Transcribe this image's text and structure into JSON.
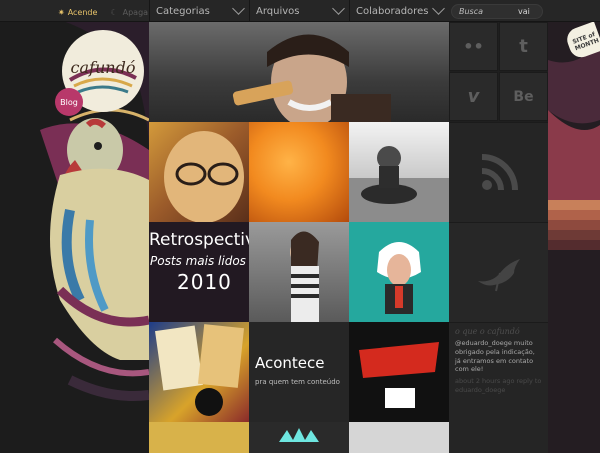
{
  "topbar": {
    "light_on": "Acende",
    "light_off": "Apaga",
    "nav": [
      "Categorias",
      "Arquivos",
      "Colaboradores"
    ],
    "search_placeholder": "Busca",
    "search_button": "vai"
  },
  "logo": {
    "text": "cafundó",
    "blog_label": "Blog"
  },
  "tiles": {
    "retro_title": "Retrospectiva",
    "retro_sub": "Posts mais lidos e",
    "retro_year": "2010",
    "acon_title": "Acontece",
    "acon_sub": "pra quem tem conteúdo"
  },
  "social": {
    "flickr": "••",
    "twitter": "t",
    "vimeo": "v",
    "behance": "Be"
  },
  "twitter_panel": {
    "header": "o que o cafundó",
    "tweet": "@eduardo_doege muito obrigado pela indicação, já entramos em contato com ele!",
    "meta": "about 2 hours ago reply to eduardo_doege"
  },
  "badge": {
    "text": "SITE of MONTH"
  }
}
